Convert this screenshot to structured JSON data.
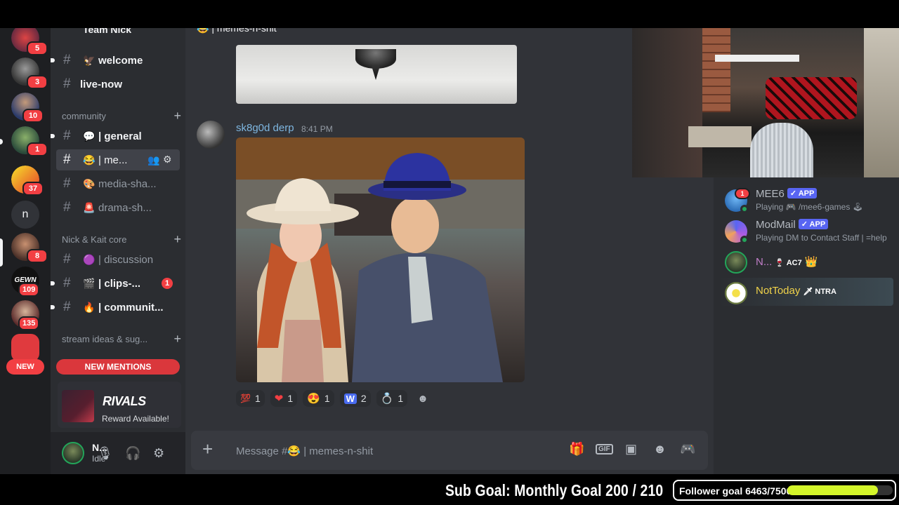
{
  "server_rail": {
    "badges": [
      "5",
      "3",
      "10",
      "1",
      "37",
      "109",
      "135",
      "8"
    ],
    "letter_server": "n",
    "new_label": "NEW"
  },
  "sidebar": {
    "server_name": "Team Nick",
    "top_channels": [
      {
        "emoji": "🦅",
        "name": "welcome"
      },
      {
        "emoji": "",
        "name": "live-now"
      }
    ],
    "categories": {
      "community": "community",
      "core": "Nick & Kait core",
      "ideas": "stream ideas & sug..."
    },
    "community_channels": [
      {
        "emoji": "💬",
        "name": "| general"
      },
      {
        "emoji": "😂",
        "name": "| me..."
      },
      {
        "emoji": "🎨",
        "name": "media-sha..."
      },
      {
        "emoji": "🚨",
        "name": "drama-sh..."
      }
    ],
    "core_channels": [
      {
        "emoji": "🟣",
        "name": "| discussion"
      },
      {
        "emoji": "🎬",
        "name": "| clips-...",
        "badge": "1"
      },
      {
        "emoji": "🔥",
        "name": "| communit..."
      }
    ],
    "new_mentions": "NEW MENTIONS",
    "promo": {
      "logo": "RIVALS",
      "text": "Reward Available!"
    },
    "user": {
      "name": "N...",
      "status": "Idle"
    }
  },
  "chat": {
    "channel_title": "😂 | memes-n-shit",
    "message": {
      "author": "sk8g0d derp",
      "time": "8:41 PM"
    },
    "reactions": [
      {
        "emoji": "💯",
        "count": "1"
      },
      {
        "emoji": "❤",
        "count": "1"
      },
      {
        "emoji": "😍",
        "count": "1"
      },
      {
        "emoji": "W",
        "count": "2"
      },
      {
        "emoji": "💍",
        "count": "1"
      }
    ],
    "composer_placeholder": "Message #😂 | memes-n-shit"
  },
  "members": [
    {
      "name": "MEE6",
      "tag": "✓ APP",
      "activity": "Playing 🎮 /mee6-games 🕹"
    },
    {
      "name": "ModMail",
      "tag": "✓ APP",
      "activity": "Playing DM to Contact Staff | =help"
    },
    {
      "name": "N...",
      "tag": "🍷 AC7",
      "extra": "👑"
    },
    {
      "name": "NotToday",
      "tag": "🗡 NTRA",
      "extra": ""
    }
  ],
  "overlay": {
    "sub_goal": "Sub Goal: Monthly Goal  200 / 210",
    "follower_goal": "Follower goal 6463/7500",
    "follower_progress": 0.862
  },
  "colors": {
    "accent_red": "#f23f43",
    "brand_blurple": "#5865f2",
    "progress_fill": "#d4f52a",
    "nottoday_name": "#f0d24a"
  }
}
